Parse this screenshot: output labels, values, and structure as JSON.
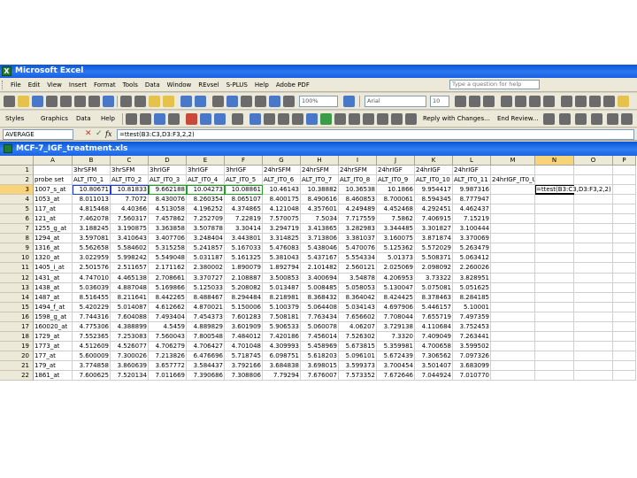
{
  "app": {
    "title": "Microsoft Excel"
  },
  "menu": {
    "items": [
      "File",
      "Edit",
      "View",
      "Insert",
      "Format",
      "Tools",
      "Data",
      "Window",
      "REvsel",
      "S-PLUS",
      "Help",
      "Adobe PDF"
    ],
    "help_placeholder": "Type a question for help"
  },
  "toolbar": {
    "zoom": "100%",
    "font": "Arial",
    "font_size": "10",
    "styles_label": "Styles",
    "graphics_label": "Graphics",
    "data_label": "Data",
    "help_label": "Help",
    "reply_label": "Reply with Changes...",
    "end_review_label": "End Review..."
  },
  "formula_bar": {
    "name_box": "AVERAGE",
    "formula": "=ttest(B3:C3,D3:F3,2,2)",
    "cancel_symbol": "✕",
    "enter_symbol": "✓",
    "fx_symbol": "fx"
  },
  "workbook": {
    "title": "MCF-7_IGF_treatment.xls",
    "columns": [
      "A",
      "B",
      "C",
      "D",
      "E",
      "F",
      "G",
      "H",
      "I",
      "J",
      "K",
      "L",
      "M",
      "N",
      "O",
      "P"
    ],
    "active_column": "N",
    "editing_formula": "=ttest(B3:C3,D3:F3,2,2)",
    "rows": [
      {
        "n": "1",
        "cells": [
          "",
          "3hrSFM",
          "3hrSFM",
          "3hrIGF",
          "3hrIGF",
          "3hrIGF",
          "24hrSFM",
          "24hrSFM",
          "24hrSFM",
          "24hrIGF",
          "24hrIGF",
          "24hrIGF",
          "",
          "",
          "",
          ""
        ]
      },
      {
        "n": "2",
        "cells": [
          "probe set",
          "ALT_IT0_1",
          "ALT_IT0_2",
          "ALT_IT0_3",
          "ALT_IT0_4",
          "ALT_IT0_5",
          "ALT_IT0_6",
          "ALT_IT0_7",
          "ALT_IT0_8",
          "ALT_IT0_9",
          "ALT_IT0_10",
          "ALT_IT0_11",
          "24hrIGF_IT0_U133A_2.0",
          "",
          "",
          ""
        ]
      },
      {
        "n": "3",
        "cells": [
          "1007_s_at",
          "10.80671",
          "10.81833",
          "9.662188",
          "10.04273",
          "10.08861",
          "10.46143",
          "10.38882",
          "10.36538",
          "10.1866",
          "9.954417",
          "9.987316",
          "",
          "",
          "",
          ""
        ]
      },
      {
        "n": "4",
        "cells": [
          "1053_at",
          "8.011013",
          "7.7072",
          "8.430076",
          "8.260354",
          "8.065107",
          "8.400175",
          "8.490616",
          "8.460853",
          "8.700061",
          "8.594345",
          "8.777947",
          "",
          "",
          "",
          ""
        ]
      },
      {
        "n": "5",
        "cells": [
          "117_at",
          "4.815468",
          "4.40366",
          "4.513058",
          "4.196252",
          "4.374865",
          "4.121048",
          "4.357601",
          "4.249489",
          "4.452468",
          "4.292451",
          "4.462437",
          "",
          "",
          "",
          ""
        ]
      },
      {
        "n": "6",
        "cells": [
          "121_at",
          "7.462078",
          "7.560317",
          "7.457862",
          "7.252709",
          "7.22819",
          "7.570075",
          "7.5034",
          "7.717559",
          "7.5862",
          "7.406915",
          "7.15219",
          "",
          "",
          "",
          ""
        ]
      },
      {
        "n": "7",
        "cells": [
          "1255_g_at",
          "3.188245",
          "3.190875",
          "3.363858",
          "3.507878",
          "3.30414",
          "3.294719",
          "3.413865",
          "3.282983",
          "3.344485",
          "3.301827",
          "3.100444",
          "",
          "",
          "",
          ""
        ]
      },
      {
        "n": "8",
        "cells": [
          "1294_at",
          "3.597081",
          "3.410643",
          "3.407706",
          "3.248404",
          "3.443801",
          "3.314825",
          "3.713806",
          "3.381037",
          "3.160075",
          "3.871874",
          "3.370069",
          "",
          "",
          "",
          ""
        ]
      },
      {
        "n": "9",
        "cells": [
          "1316_at",
          "5.562658",
          "5.584602",
          "5.315258",
          "5.241857",
          "5.167033",
          "5.476083",
          "5.438046",
          "5.470076",
          "5.125362",
          "5.572029",
          "5.263479",
          "",
          "",
          "",
          ""
        ]
      },
      {
        "n": "10",
        "cells": [
          "1320_at",
          "3.022959",
          "5.998242",
          "5.549048",
          "5.031187",
          "5.161325",
          "5.381043",
          "5.437167",
          "5.554334",
          "5.01373",
          "5.508371",
          "5.063412",
          "",
          "",
          "",
          ""
        ]
      },
      {
        "n": "11",
        "cells": [
          "1405_i_at",
          "2.501576",
          "2.511657",
          "2.171162",
          "2.380002",
          "1.890079",
          "1.892794",
          "2.101482",
          "2.560121",
          "2.025069",
          "2.098092",
          "2.260026",
          "",
          "",
          "",
          ""
        ]
      },
      {
        "n": "12",
        "cells": [
          "1431_at",
          "4.747010",
          "4.465138",
          "2.708661",
          "3.370727",
          "2.108887",
          "3.500853",
          "3.400694",
          "3.54878",
          "4.206953",
          "3.73322",
          "3.828951",
          "",
          "",
          "",
          ""
        ]
      },
      {
        "n": "13",
        "cells": [
          "1438_at",
          "5.036039",
          "4.887048",
          "5.169866",
          "5.125033",
          "5.208082",
          "5.013487",
          "5.008485",
          "5.058053",
          "5.130047",
          "5.075081",
          "5.051625",
          "",
          "",
          "",
          ""
        ]
      },
      {
        "n": "14",
        "cells": [
          "1487_at",
          "8.516455",
          "8.211641",
          "8.442265",
          "8.488467",
          "8.294484",
          "8.218981",
          "8.368432",
          "8.364042",
          "8.424425",
          "8.378463",
          "8.284185",
          "",
          "",
          "",
          ""
        ]
      },
      {
        "n": "15",
        "cells": [
          "1494_f_at",
          "5.420229",
          "5.014087",
          "4.612662",
          "4.870021",
          "5.150006",
          "5.100379",
          "5.064408",
          "5.034143",
          "4.697906",
          "5.446157",
          "5.10001",
          "",
          "",
          "",
          ""
        ]
      },
      {
        "n": "16",
        "cells": [
          "1598_g_at",
          "7.744316",
          "7.604088",
          "7.493404",
          "7.454373",
          "7.601283",
          "7.508181",
          "7.763434",
          "7.656602",
          "7.708044",
          "7.655719",
          "7.497359",
          "",
          "",
          "",
          ""
        ]
      },
      {
        "n": "17",
        "cells": [
          "160020_at",
          "4.775306",
          "4.388899",
          "4.5459",
          "4.889829",
          "3.601909",
          "5.906533",
          "5.060078",
          "4.06207",
          "3.729138",
          "4.110684",
          "3.752453",
          "",
          "",
          "",
          ""
        ]
      },
      {
        "n": "18",
        "cells": [
          "1729_at",
          "7.552365",
          "7.253083",
          "7.560043",
          "7.800548",
          "7.484012",
          "7.420186",
          "7.456014",
          "7.526302",
          "7.3320",
          "7.409049",
          "7.263441",
          "",
          "",
          "",
          ""
        ]
      },
      {
        "n": "19",
        "cells": [
          "1773_at",
          "4.512609",
          "4.526077",
          "4.706279",
          "4.706427",
          "4.701048",
          "4.309993",
          "5.458969",
          "5.673815",
          "5.359981",
          "4.700658",
          "3.599502",
          "",
          "",
          "",
          ""
        ]
      },
      {
        "n": "20",
        "cells": [
          "177_at",
          "5.600009",
          "7.300026",
          "7.213826",
          "6.476696",
          "5.718745",
          "6.098751",
          "5.618203",
          "5.096101",
          "5.672439",
          "7.306562",
          "7.097326",
          "",
          "",
          "",
          ""
        ]
      },
      {
        "n": "21",
        "cells": [
          "179_at",
          "3.774858",
          "3.860639",
          "3.657772",
          "3.584437",
          "3.792166",
          "3.684838",
          "3.698015",
          "3.599373",
          "3.700454",
          "3.501407",
          "3.683099",
          "",
          "",
          "",
          ""
        ]
      },
      {
        "n": "22",
        "cells": [
          "1861_at",
          "7.600625",
          "7.520134",
          "7.011669",
          "7.390686",
          "7.308806",
          "7.79294",
          "7.676007",
          "7.573352",
          "7.672646",
          "7.044924",
          "7.010770",
          "",
          "",
          "",
          ""
        ]
      }
    ]
  },
  "colors": {
    "title_bar": "#0a56d8",
    "chrome": "#ece9d8",
    "active_header": "#f8d37a",
    "range_blue": "#2040d0",
    "range_green": "#20a020"
  }
}
